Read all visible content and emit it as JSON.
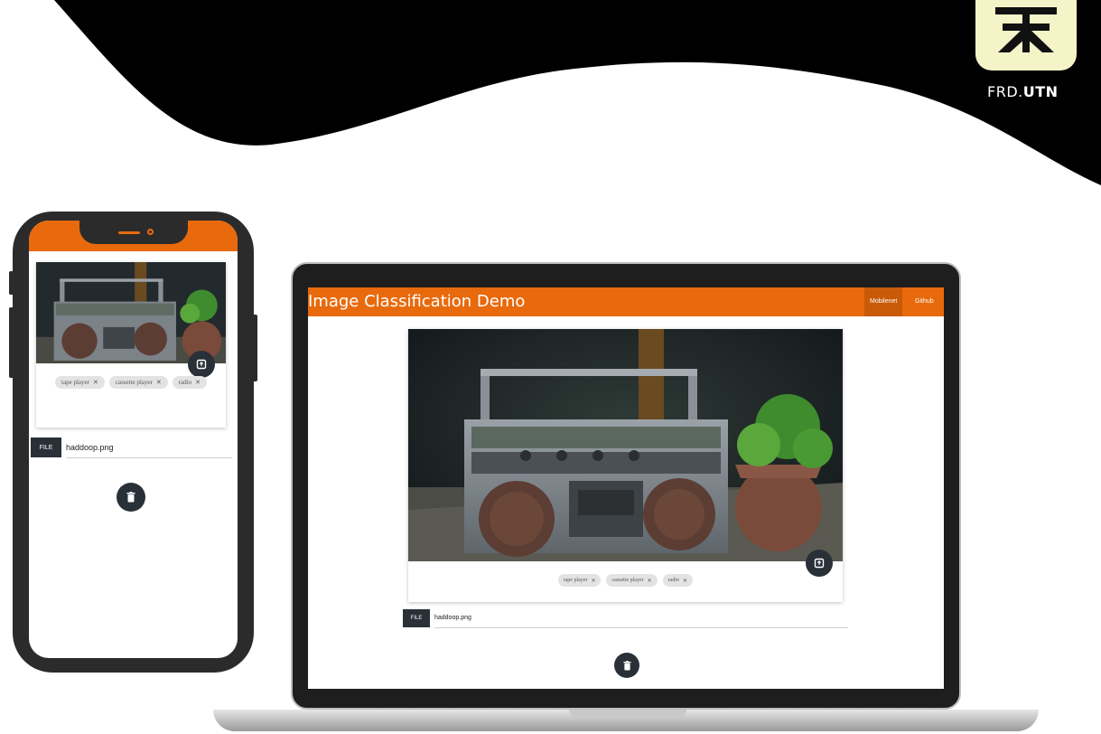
{
  "brand": {
    "prefix": "FRD.",
    "strong": "UTN"
  },
  "colors": {
    "accent": "#e86a0c",
    "dark": "#2a3038",
    "chip": "#e3e3e3"
  },
  "app": {
    "title": "Image Classification Demo",
    "nav": [
      {
        "label": "Mobilenet",
        "active": true
      },
      {
        "label": "Github",
        "active": false
      }
    ]
  },
  "predictions": [
    "tape player",
    "cassette player",
    "radio"
  ],
  "file": {
    "button_label": "FILE",
    "value": "haddoop.png"
  },
  "icons": {
    "upload": "image-upload-icon",
    "delete": "trash-icon",
    "chip_remove": "close-icon"
  }
}
